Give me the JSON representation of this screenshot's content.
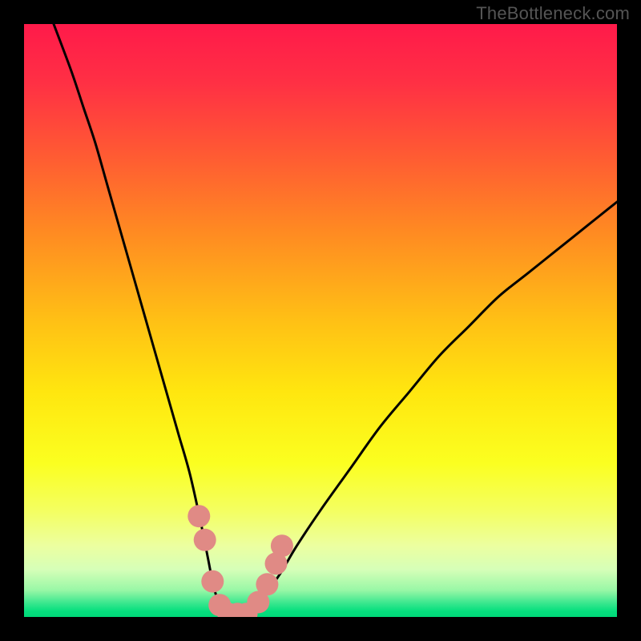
{
  "watermark": "TheBottleneck.com",
  "chart_data": {
    "type": "line",
    "title": "",
    "xlabel": "",
    "ylabel": "",
    "xlim": [
      0,
      100
    ],
    "ylim": [
      0,
      100
    ],
    "grid": false,
    "series": [
      {
        "name": "bottleneck-curve",
        "x": [
          5,
          8,
          10,
          12,
          14,
          16,
          18,
          20,
          22,
          24,
          26,
          28,
          30,
          31,
          32,
          33,
          34,
          35,
          37,
          40,
          43,
          46,
          50,
          55,
          60,
          65,
          70,
          75,
          80,
          85,
          90,
          95,
          100
        ],
        "values": [
          100,
          92,
          86,
          80,
          73,
          66,
          59,
          52,
          45,
          38,
          31,
          24,
          15,
          10,
          5,
          2,
          0,
          0,
          0,
          3,
          7,
          12,
          18,
          25,
          32,
          38,
          44,
          49,
          54,
          58,
          62,
          66,
          70
        ]
      }
    ],
    "markers": {
      "name": "highlight-points",
      "color": "#e08a85",
      "points": [
        {
          "x": 29.5,
          "y": 17
        },
        {
          "x": 30.5,
          "y": 13
        },
        {
          "x": 31.8,
          "y": 6
        },
        {
          "x": 33.0,
          "y": 2
        },
        {
          "x": 34.5,
          "y": 0.5
        },
        {
          "x": 36.0,
          "y": 0.5
        },
        {
          "x": 37.5,
          "y": 0.5
        },
        {
          "x": 39.5,
          "y": 2.5
        },
        {
          "x": 41.0,
          "y": 5.5
        },
        {
          "x": 42.5,
          "y": 9
        },
        {
          "x": 43.5,
          "y": 12
        }
      ]
    },
    "gradient_stops": [
      {
        "pos": 0.0,
        "color": "#ff1a4a"
      },
      {
        "pos": 0.1,
        "color": "#ff3044"
      },
      {
        "pos": 0.22,
        "color": "#ff5a33"
      },
      {
        "pos": 0.35,
        "color": "#ff8a22"
      },
      {
        "pos": 0.5,
        "color": "#ffc015"
      },
      {
        "pos": 0.62,
        "color": "#ffe60f"
      },
      {
        "pos": 0.74,
        "color": "#fbff20"
      },
      {
        "pos": 0.82,
        "color": "#f4ff60"
      },
      {
        "pos": 0.88,
        "color": "#ecffa0"
      },
      {
        "pos": 0.92,
        "color": "#d6ffb8"
      },
      {
        "pos": 0.955,
        "color": "#98f7a6"
      },
      {
        "pos": 0.975,
        "color": "#40e890"
      },
      {
        "pos": 0.99,
        "color": "#06df7e"
      },
      {
        "pos": 1.0,
        "color": "#00d878"
      }
    ]
  }
}
